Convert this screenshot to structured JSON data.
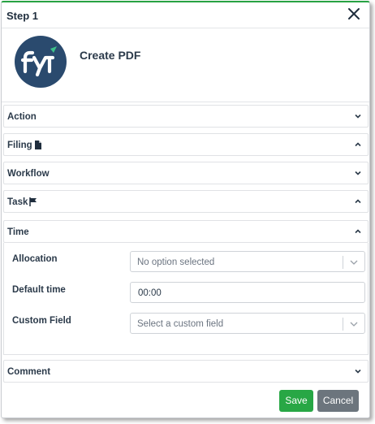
{
  "dialog": {
    "title": "Step 1"
  },
  "hero": {
    "name": "Create PDF",
    "logo_text": "fyi"
  },
  "sections": {
    "action": {
      "label": "Action",
      "state": "collapsed"
    },
    "filing": {
      "label": "Filing",
      "state": "expanded",
      "icon": "document-icon"
    },
    "workflow": {
      "label": "Workflow",
      "state": "collapsed"
    },
    "task": {
      "label": "Task",
      "state": "expanded",
      "icon": "flag-icon"
    },
    "time": {
      "label": "Time",
      "state": "expanded"
    },
    "comment": {
      "label": "Comment",
      "state": "collapsed"
    }
  },
  "time": {
    "allocation": {
      "label": "Allocation",
      "placeholder": "No option selected"
    },
    "default_time": {
      "label": "Default time",
      "value": "00:00"
    },
    "custom_field": {
      "label": "Custom Field",
      "placeholder": "Select a custom field"
    }
  },
  "footer": {
    "save_label": "Save",
    "cancel_label": "Cancel"
  },
  "colors": {
    "accent_green": "#28a745",
    "secondary_gray": "#6c757d",
    "logo_navy": "#2a4a6e",
    "logo_green": "#3cc08a",
    "top_border": "#27a243"
  }
}
